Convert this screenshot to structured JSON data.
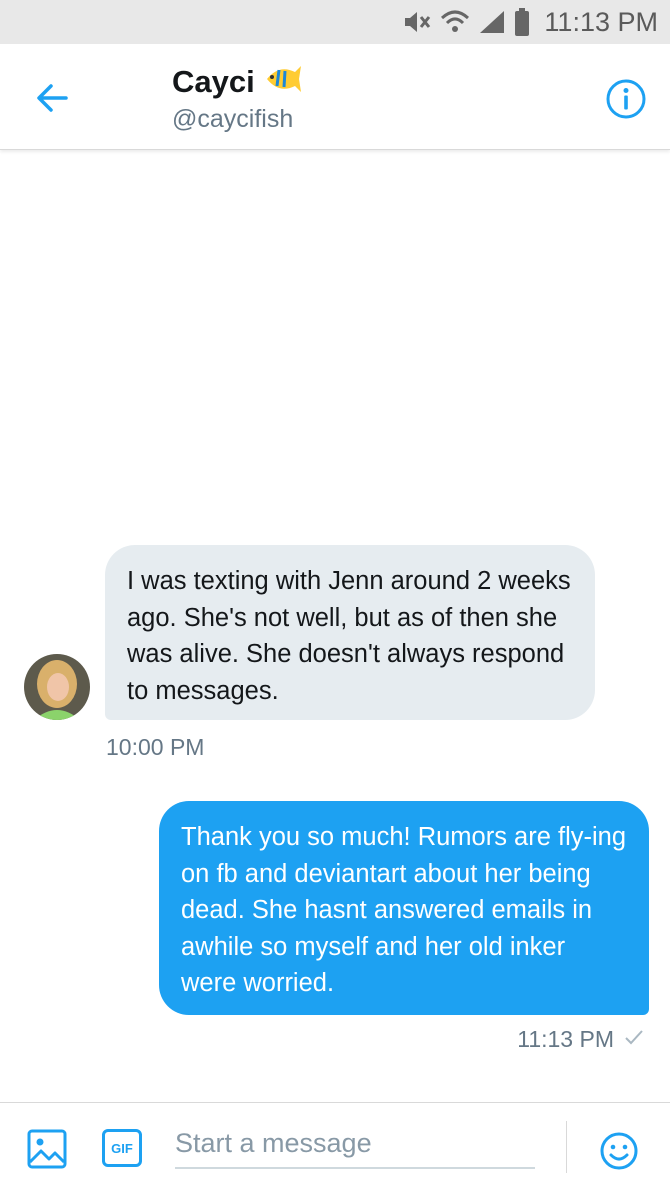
{
  "status_bar": {
    "time": "11:13 PM",
    "icons": [
      "mute-icon",
      "wifi-icon",
      "signal-icon",
      "battery-icon"
    ]
  },
  "header": {
    "name": "Cayci",
    "handle": "@caycifish",
    "name_emoji": "tropical-fish-icon",
    "back_icon": "back-arrow-icon",
    "info_icon": "info-icon"
  },
  "conversation": {
    "messages": [
      {
        "direction": "incoming",
        "text": "I was texting with Jenn around 2 weeks ago. She's not well, but as of then she was alive. She doesn't always respond to messages.",
        "time": "10:00 PM"
      },
      {
        "direction": "outgoing",
        "text": "Thank you so much! Rumors are fly-ing on fb and deviantart about her being dead. She hasnt answered emails in awhile so myself and her old inker were worried.",
        "time": "11:13 PM",
        "status": "sent-check-icon"
      }
    ]
  },
  "composer": {
    "placeholder": "Start a message",
    "value": "",
    "gif_label": "GIF"
  },
  "colors": {
    "accent": "#1da1f2",
    "incoming_bubble": "#e6ecf0",
    "secondary_text": "#657786",
    "status_bar_bg": "#e8e8e8"
  }
}
